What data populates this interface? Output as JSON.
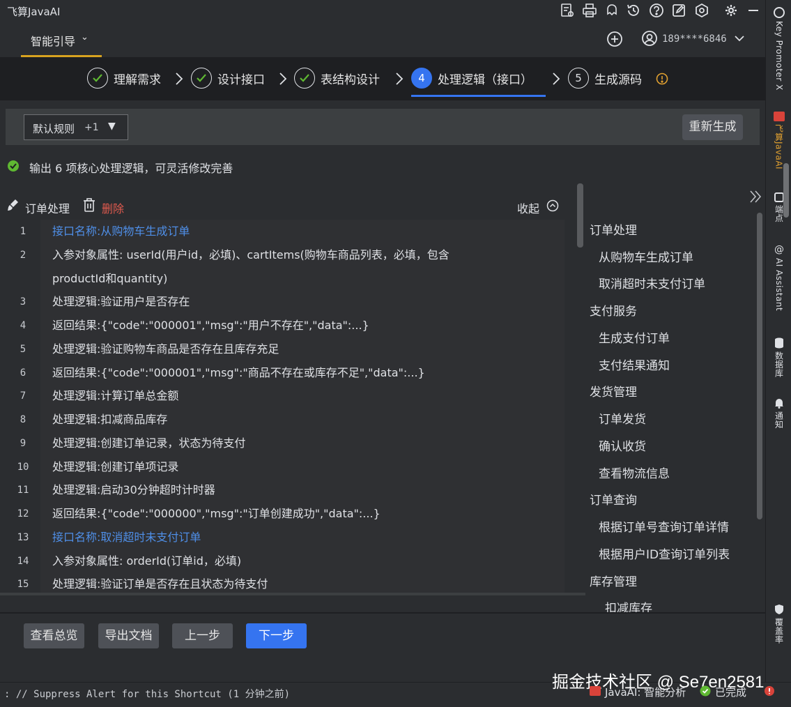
{
  "app": {
    "title": "飞算JavaAI"
  },
  "header": {
    "guide_tab": "智能引导",
    "user_phone": "189****6846"
  },
  "stepper": {
    "steps": [
      {
        "label": "理解需求",
        "state": "done"
      },
      {
        "label": "设计接口",
        "state": "done"
      },
      {
        "label": "表结构设计",
        "state": "done"
      },
      {
        "label": "处理逻辑（接口）",
        "state": "active",
        "number": "4"
      },
      {
        "label": "生成源码",
        "state": "todo",
        "number": "5"
      }
    ]
  },
  "toolbar": {
    "rule_select_label": "默认规则",
    "rule_select_count": "+1",
    "regen_label": "重新生成"
  },
  "output_message": "输出 6 项核心处理逻辑，可灵活修改完善",
  "section": {
    "title": "订单处理",
    "delete_label": "删除",
    "collapse_label": "收起"
  },
  "code_lines": [
    {
      "n": "1",
      "text": "接口名称:从购物车生成订单",
      "kind": "api"
    },
    {
      "n": "2",
      "text": "入参对象属性: userId(用户id，必填)、cartItems(购物车商品列表，必填，包含",
      "kind": "text"
    },
    {
      "n": "",
      "text": "productId和quantity)",
      "kind": "text"
    },
    {
      "n": "3",
      "text": "处理逻辑:验证用户是否存在",
      "kind": "text"
    },
    {
      "n": "4",
      "text": "返回结果:{\"code\":\"000001\",\"msg\":\"用户不存在\",\"data\":...}",
      "kind": "text"
    },
    {
      "n": "5",
      "text": "处理逻辑:验证购物车商品是否存在且库存充足",
      "kind": "text"
    },
    {
      "n": "6",
      "text": "返回结果:{\"code\":\"000001\",\"msg\":\"商品不存在或库存不足\",\"data\":...}",
      "kind": "text"
    },
    {
      "n": "7",
      "text": "处理逻辑:计算订单总金额",
      "kind": "text"
    },
    {
      "n": "8",
      "text": "处理逻辑:扣减商品库存",
      "kind": "text"
    },
    {
      "n": "9",
      "text": "处理逻辑:创建订单记录，状态为待支付",
      "kind": "text"
    },
    {
      "n": "10",
      "text": "处理逻辑:创建订单项记录",
      "kind": "text"
    },
    {
      "n": "11",
      "text": "处理逻辑:启动30分钟超时计时器",
      "kind": "text"
    },
    {
      "n": "12",
      "text": "返回结果:{\"code\":\"000000\",\"msg\":\"订单创建成功\",\"data\":...}",
      "kind": "text"
    },
    {
      "n": "13",
      "text": "接口名称:取消超时未支付订单",
      "kind": "api"
    },
    {
      "n": "14",
      "text": "入参对象属性: orderId(订单id，必填)",
      "kind": "text"
    },
    {
      "n": "15",
      "text": "处理逻辑:验证订单是否存在且状态为待支付",
      "kind": "text"
    }
  ],
  "outline": [
    {
      "label": "订单处理",
      "level": 0
    },
    {
      "label": "从购物车生成订单",
      "level": 1
    },
    {
      "label": "取消超时未支付订单",
      "level": 1
    },
    {
      "label": "支付服务",
      "level": 0
    },
    {
      "label": "生成支付订单",
      "level": 1
    },
    {
      "label": "支付结果通知",
      "level": 1
    },
    {
      "label": "发货管理",
      "level": 0
    },
    {
      "label": "订单发货",
      "level": 1
    },
    {
      "label": "确认收货",
      "level": 1
    },
    {
      "label": "查看物流信息",
      "level": 1
    },
    {
      "label": "订单查询",
      "level": 0
    },
    {
      "label": "根据订单号查询订单详情",
      "level": 1
    },
    {
      "label": "根据用户ID查询订单列表",
      "level": 1
    },
    {
      "label": "库存管理",
      "level": 0
    },
    {
      "label": "扣减库存",
      "level": 1
    }
  ],
  "buttons": {
    "overview": "查看总览",
    "export": "导出文档",
    "prev": "上一步",
    "next": "下一步"
  },
  "statusbar": {
    "text": ": // Suppress Alert for this Shortcut (1 分钟之前)",
    "plugin": "JavaAI: 智能分析",
    "done": "已完成"
  },
  "watermark": "掘金技术社区 @ Se7en2581",
  "rightbar": {
    "items": [
      "Key Promoter X",
      "飞算JavaAI",
      "端点",
      "AI Assistant",
      "数据库",
      "通知",
      "覆盖率"
    ]
  },
  "colors": {
    "accent_blue": "#3574f0",
    "tab_underline": "#d8a31f",
    "delete_red": "#e05a4e",
    "api_blue": "#4f8fe8",
    "success_green": "#5fb832"
  }
}
